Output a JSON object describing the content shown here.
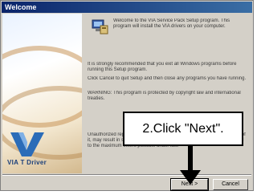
{
  "window": {
    "title": "Welcome"
  },
  "left_panel": {
    "logo_icon": "via-logo-icon",
    "logo_caption": "VIA T Driver"
  },
  "content": {
    "icon": "setup-icon",
    "paragraphs": [
      "Welcome to the VIA Service Pack Setup program. This program will install the VIA drivers on your computer.",
      "It is strongly recommended that you exit all Windows programs before running this Setup program.",
      "Click Cancel to quit Setup and then close any programs you have running.",
      "WARNING: This program is protected by copyright law and international treaties.",
      "Unauthorized reproduction or distribution of this program, or any portion of it, may result in severe civil and criminal penalties, and will be prosecuted to the maximum extent possible under law."
    ]
  },
  "buttons": {
    "next_label": "Next >",
    "cancel_label": "Cancel"
  },
  "annotation": {
    "callout_text": "2.Click \"Next\"."
  },
  "colors": {
    "titlebar": "#0a246a",
    "dialog_face": "#d4d0c8",
    "logo_blue": "#1b3f7a"
  }
}
